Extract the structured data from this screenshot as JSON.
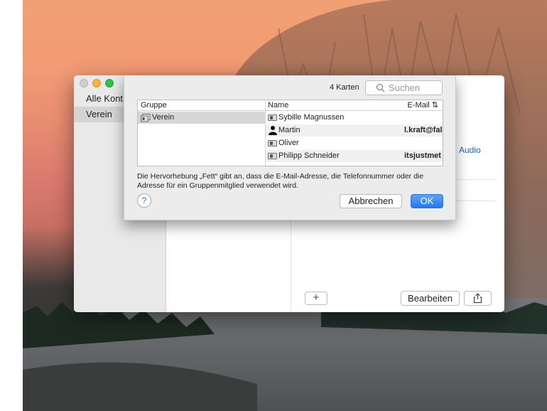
{
  "sidebar": {
    "items": [
      {
        "label": "Alle Kont"
      },
      {
        "label": "Verein",
        "selected": true
      }
    ]
  },
  "detail": {
    "audio_label": "Audio"
  },
  "toolbar": {
    "add_label": "+",
    "edit_label": "Bearbeiten",
    "share_icon": "share-icon"
  },
  "sheet": {
    "card_count": "4 Karten",
    "search_placeholder": "Suchen",
    "table": {
      "group_header": "Gruppe",
      "name_header": "Name",
      "email_header": "E-Mail",
      "groups": [
        {
          "label": "Verein"
        }
      ],
      "rows": [
        {
          "name": "Sybille Magnussen",
          "email": "",
          "icon": "contact-card-icon"
        },
        {
          "name": "Martin",
          "email": "l.kraft@fal",
          "icon": "person-icon"
        },
        {
          "name": "Oliver",
          "email": "",
          "icon": "contact-card-icon"
        },
        {
          "name": "Philipp Schneider",
          "email": "itsjustmet",
          "icon": "contact-card-icon"
        }
      ]
    },
    "info_text": "Die Hervorhebung „Fett“ gibt an, dass die E-Mail-Adresse, die Telefonnummer oder die Adresse für ein Gruppenmitglied verwendet wird.",
    "help_label": "?",
    "cancel_label": "Abbrechen",
    "ok_label": "OK"
  },
  "colors": {
    "accent": "#2778ea",
    "link": "#1f63c8"
  }
}
